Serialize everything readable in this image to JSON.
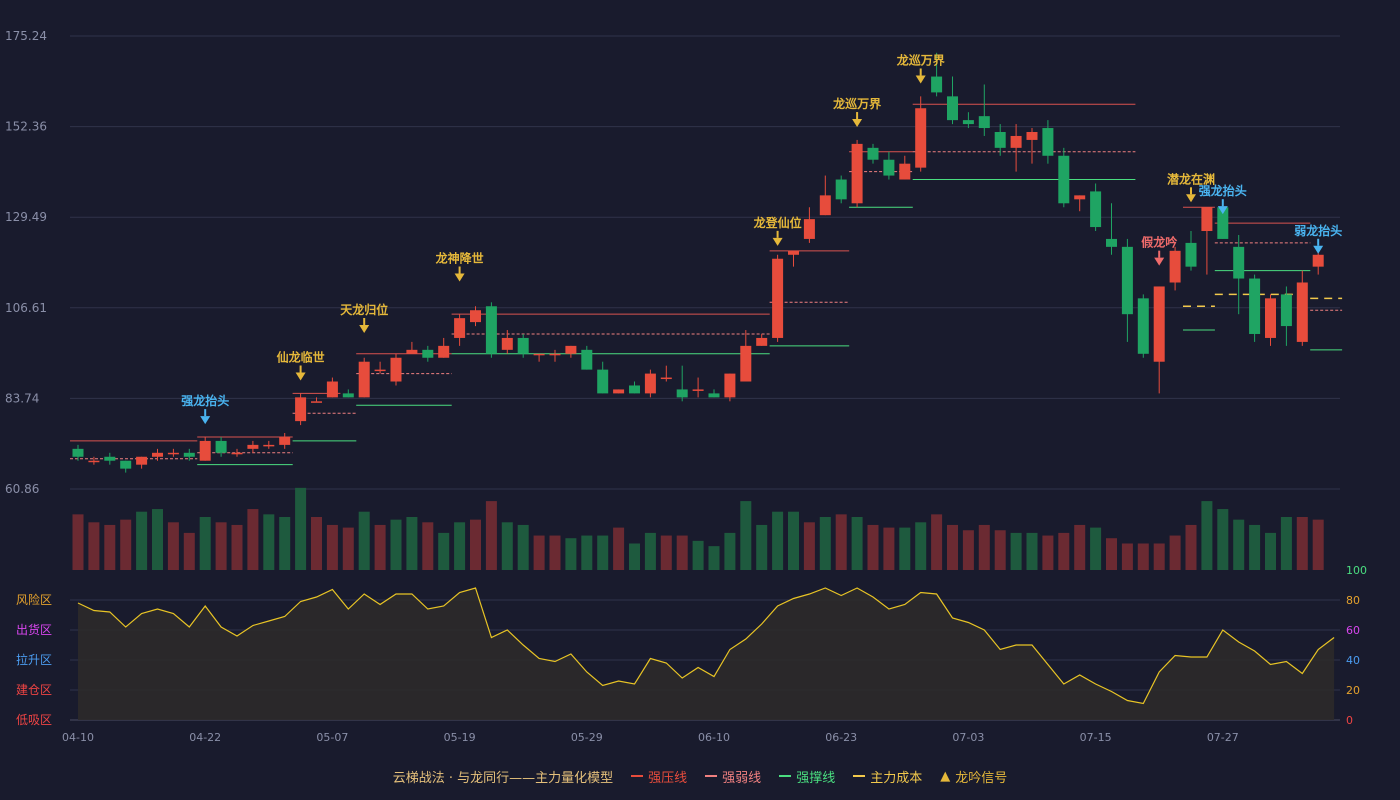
{
  "chart_data": {
    "type": "candlestick",
    "x_tick_labels": [
      "04-10",
      "04-22",
      "05-07",
      "05-19",
      "05-29",
      "06-10",
      "06-23",
      "07-03",
      "07-15",
      "07-27"
    ],
    "price_axis": {
      "ticks": [
        "175.24",
        "152.36",
        "129.49",
        "106.61",
        "83.74",
        "60.86"
      ],
      "range": [
        60.86,
        175.24
      ]
    },
    "indicator_axis": {
      "ticks": [
        0,
        20,
        40,
        60,
        80,
        100
      ],
      "range": [
        0,
        100
      ]
    },
    "zone_labels": [
      {
        "text": "风险区",
        "color": "#e5a22d"
      },
      {
        "text": "出货区",
        "color": "#d946ef"
      },
      {
        "text": "拉升区",
        "color": "#4b9cf0"
      },
      {
        "text": "建仓区",
        "color": "#ef4444"
      },
      {
        "text": "低吸区",
        "color": "#ef4444"
      }
    ],
    "colors": {
      "up": "#e74c3c",
      "down": "#1fa463",
      "grid": "#30334a",
      "indicator": "#e8c425",
      "support": "#4ade80",
      "cost": "#f2c94c"
    },
    "candles": [
      [
        71,
        69,
        72,
        68
      ],
      [
        68,
        68,
        69,
        67
      ],
      [
        69,
        68,
        70,
        67
      ],
      [
        68,
        66,
        68,
        65
      ],
      [
        67,
        69,
        69,
        66
      ],
      [
        69,
        70,
        71,
        68
      ],
      [
        70,
        70,
        71,
        69
      ],
      [
        70,
        69,
        71,
        68
      ],
      [
        68,
        73,
        74,
        68
      ],
      [
        73,
        70,
        74,
        69
      ],
      [
        70,
        70,
        71,
        69
      ],
      [
        71,
        72,
        73,
        70
      ],
      [
        72,
        72,
        73,
        71
      ],
      [
        72,
        74,
        75,
        71
      ],
      [
        78,
        84,
        85,
        77
      ],
      [
        83,
        83,
        84,
        83
      ],
      [
        84,
        88,
        89,
        84
      ],
      [
        85,
        84,
        86,
        84
      ],
      [
        84,
        93,
        94,
        84
      ],
      [
        91,
        91,
        93,
        90
      ],
      [
        88,
        94,
        95,
        87
      ],
      [
        95,
        96,
        98,
        95
      ],
      [
        96,
        94,
        97,
        93
      ],
      [
        94,
        97,
        99,
        94
      ],
      [
        99,
        104,
        105,
        97
      ],
      [
        103,
        106,
        107,
        102
      ],
      [
        107,
        95,
        108,
        94
      ],
      [
        96,
        99,
        101,
        95
      ],
      [
        99,
        95,
        100,
        94
      ],
      [
        95,
        95,
        95,
        93
      ],
      [
        95,
        95,
        96,
        93
      ],
      [
        95,
        97,
        97,
        94
      ],
      [
        96,
        91,
        97,
        91
      ],
      [
        91,
        85,
        93,
        85
      ],
      [
        85,
        86,
        86,
        85
      ],
      [
        87,
        85,
        88,
        85
      ],
      [
        85,
        90,
        91,
        84
      ],
      [
        89,
        89,
        92,
        88
      ],
      [
        86,
        84,
        92,
        83
      ],
      [
        86,
        86,
        89,
        84
      ],
      [
        85,
        84,
        86,
        84
      ],
      [
        84,
        90,
        90,
        83
      ],
      [
        88,
        97,
        101,
        88
      ],
      [
        97,
        99,
        100,
        97
      ],
      [
        99,
        119,
        120,
        98
      ],
      [
        120,
        121,
        121,
        117
      ],
      [
        124,
        129,
        132,
        123
      ],
      [
        130,
        135,
        140,
        130
      ],
      [
        139,
        134,
        140,
        133
      ],
      [
        133,
        148,
        149,
        132
      ],
      [
        147,
        144,
        148,
        143
      ],
      [
        144,
        140,
        146,
        139
      ],
      [
        139,
        143,
        145,
        139
      ],
      [
        142,
        157,
        160,
        141
      ],
      [
        165,
        161,
        171,
        160
      ],
      [
        160,
        154,
        165,
        153
      ],
      [
        154,
        153,
        156,
        152
      ],
      [
        155,
        152,
        163,
        150
      ],
      [
        151,
        147,
        153,
        145
      ],
      [
        147,
        150,
        153,
        141
      ],
      [
        149,
        151,
        152,
        143
      ],
      [
        152,
        145,
        154,
        143
      ],
      [
        145,
        133,
        147,
        132
      ],
      [
        134,
        135,
        135,
        131
      ],
      [
        136,
        127,
        138,
        126
      ],
      [
        124,
        122,
        133,
        120
      ],
      [
        122,
        105,
        124,
        98
      ],
      [
        109,
        95,
        110,
        94
      ],
      [
        93,
        112,
        112,
        85
      ],
      [
        113,
        121,
        122,
        111
      ],
      [
        123,
        117,
        126,
        116
      ],
      [
        126,
        132,
        132,
        115
      ],
      [
        132,
        124,
        133,
        124
      ],
      [
        122,
        114,
        125,
        105
      ],
      [
        114,
        100,
        115,
        98
      ],
      [
        99,
        109,
        110,
        97
      ],
      [
        110,
        102,
        112,
        97
      ],
      [
        98,
        113,
        116,
        97
      ],
      [
        117,
        120,
        121,
        115
      ]
    ],
    "volume": [
      [
        21,
        "up"
      ],
      [
        18,
        "up"
      ],
      [
        17,
        "up"
      ],
      [
        19,
        "up"
      ],
      [
        22,
        "down"
      ],
      [
        23,
        "down"
      ],
      [
        18,
        "up"
      ],
      [
        14,
        "up"
      ],
      [
        20,
        "down"
      ],
      [
        18,
        "up"
      ],
      [
        17,
        "up"
      ],
      [
        23,
        "up"
      ],
      [
        21,
        "down"
      ],
      [
        20,
        "down"
      ],
      [
        31,
        "down"
      ],
      [
        20,
        "up"
      ],
      [
        17,
        "up"
      ],
      [
        16,
        "up"
      ],
      [
        22,
        "down"
      ],
      [
        17,
        "up"
      ],
      [
        19,
        "down"
      ],
      [
        20,
        "down"
      ],
      [
        18,
        "up"
      ],
      [
        14,
        "down"
      ],
      [
        18,
        "down"
      ],
      [
        19,
        "up"
      ],
      [
        26,
        "up"
      ],
      [
        18,
        "down"
      ],
      [
        17,
        "down"
      ],
      [
        13,
        "up"
      ],
      [
        13,
        "up"
      ],
      [
        12,
        "down"
      ],
      [
        13,
        "down"
      ],
      [
        13,
        "down"
      ],
      [
        16,
        "up"
      ],
      [
        10,
        "down"
      ],
      [
        14,
        "down"
      ],
      [
        13,
        "up"
      ],
      [
        13,
        "up"
      ],
      [
        11,
        "down"
      ],
      [
        9,
        "down"
      ],
      [
        14,
        "down"
      ],
      [
        26,
        "down"
      ],
      [
        17,
        "down"
      ],
      [
        22,
        "down"
      ],
      [
        22,
        "down"
      ],
      [
        18,
        "up"
      ],
      [
        20,
        "down"
      ],
      [
        21,
        "up"
      ],
      [
        20,
        "down"
      ],
      [
        17,
        "up"
      ],
      [
        16,
        "up"
      ],
      [
        16,
        "down"
      ],
      [
        18,
        "down"
      ],
      [
        21,
        "up"
      ],
      [
        17,
        "up"
      ],
      [
        15,
        "up"
      ],
      [
        17,
        "up"
      ],
      [
        15,
        "up"
      ],
      [
        14,
        "down"
      ],
      [
        14,
        "down"
      ],
      [
        13,
        "up"
      ],
      [
        14,
        "up"
      ],
      [
        17,
        "up"
      ],
      [
        16,
        "down"
      ],
      [
        12,
        "up"
      ],
      [
        10,
        "up"
      ],
      [
        10,
        "up"
      ],
      [
        10,
        "up"
      ],
      [
        13,
        "up"
      ],
      [
        17,
        "up"
      ],
      [
        26,
        "down"
      ],
      [
        23,
        "down"
      ],
      [
        19,
        "down"
      ],
      [
        17,
        "down"
      ],
      [
        14,
        "down"
      ],
      [
        20,
        "down"
      ],
      [
        20,
        "up"
      ],
      [
        19,
        "up"
      ]
    ],
    "indicator": [
      78,
      73,
      72,
      62,
      71,
      74,
      71,
      62,
      76,
      62,
      56,
      63,
      66,
      69,
      79,
      82,
      87,
      74,
      84,
      77,
      84,
      84,
      74,
      76,
      85,
      88,
      55,
      60,
      50,
      41,
      39,
      44,
      32,
      23,
      26,
      24,
      41,
      38,
      28,
      35,
      29,
      47,
      54,
      64,
      76,
      81,
      84,
      88,
      83,
      88,
      82,
      74,
      77,
      85,
      84,
      68,
      65,
      60,
      47,
      50,
      50,
      37,
      24,
      30,
      24,
      19,
      13,
      11,
      32,
      43,
      42,
      42,
      60,
      52,
      46,
      37,
      39,
      31,
      47,
      55
    ],
    "signals": [
      {
        "text": "强龙抬头",
        "index": 8,
        "price": 77,
        "color": "#4ab4f0"
      },
      {
        "text": "仙龙临世",
        "index": 14,
        "price": 88,
        "color": "#e5b83a"
      },
      {
        "text": "天龙归位",
        "index": 18,
        "price": 100,
        "color": "#e5b83a"
      },
      {
        "text": "龙神降世",
        "index": 24,
        "price": 113,
        "color": "#e5b83a"
      },
      {
        "text": "龙登仙位",
        "index": 44,
        "price": 122,
        "color": "#e5b83a"
      },
      {
        "text": "龙巡万界",
        "index": 49,
        "price": 152,
        "color": "#e5b83a"
      },
      {
        "text": "龙巡万界",
        "index": 53,
        "price": 163,
        "color": "#e5b83a"
      },
      {
        "text": "潜龙在渊",
        "index": 70,
        "price": 133,
        "color": "#e5b83a"
      },
      {
        "text": "假龙吟",
        "index": 68,
        "price": 117,
        "color": "#ef6b6b"
      },
      {
        "text": "强龙抬头",
        "index": 72,
        "price": 130,
        "color": "#4ab4f0"
      },
      {
        "text": "弱龙抬头",
        "index": 78,
        "price": 120,
        "color": "#4ab4f0"
      }
    ],
    "levels": [
      {
        "kind": "strong_pressure",
        "start": 0,
        "end": 7,
        "price": 73
      },
      {
        "kind": "weak_pressure",
        "start": 0,
        "end": 7,
        "price": 68.5
      },
      {
        "kind": "strong_pressure",
        "start": 8,
        "end": 13,
        "price": 74
      },
      {
        "kind": "weak_pressure",
        "start": 8,
        "end": 13,
        "price": 70
      },
      {
        "kind": "support",
        "start": 8,
        "end": 13,
        "price": 67
      },
      {
        "kind": "strong_pressure",
        "start": 14,
        "end": 16,
        "price": 85
      },
      {
        "kind": "weak_pressure",
        "start": 14,
        "end": 17,
        "price": 80
      },
      {
        "kind": "support",
        "start": 14,
        "end": 17,
        "price": 73
      },
      {
        "kind": "strong_pressure",
        "start": 18,
        "end": 23,
        "price": 95
      },
      {
        "kind": "weak_pressure",
        "start": 18,
        "end": 23,
        "price": 90
      },
      {
        "kind": "support",
        "start": 18,
        "end": 23,
        "price": 82
      },
      {
        "kind": "strong_pressure",
        "start": 24,
        "end": 43,
        "price": 105
      },
      {
        "kind": "weak_pressure",
        "start": 24,
        "end": 43,
        "price": 100
      },
      {
        "kind": "support",
        "start": 24,
        "end": 43,
        "price": 95
      },
      {
        "kind": "strong_pressure",
        "start": 44,
        "end": 48,
        "price": 121
      },
      {
        "kind": "weak_pressure",
        "start": 44,
        "end": 48,
        "price": 108
      },
      {
        "kind": "support",
        "start": 44,
        "end": 48,
        "price": 97
      },
      {
        "kind": "strong_pressure",
        "start": 49,
        "end": 52,
        "price": 146
      },
      {
        "kind": "weak_pressure",
        "start": 49,
        "end": 52,
        "price": 141
      },
      {
        "kind": "support",
        "start": 49,
        "end": 52,
        "price": 132
      },
      {
        "kind": "strong_pressure",
        "start": 53,
        "end": 66,
        "price": 158
      },
      {
        "kind": "weak_pressure",
        "start": 53,
        "end": 66,
        "price": 146
      },
      {
        "kind": "support",
        "start": 53,
        "end": 66,
        "price": 139
      },
      {
        "kind": "strong_pressure",
        "start": 70,
        "end": 71,
        "price": 132
      },
      {
        "kind": "cost",
        "start": 70,
        "end": 71,
        "price": 107
      },
      {
        "kind": "support",
        "start": 70,
        "end": 71,
        "price": 101
      },
      {
        "kind": "strong_pressure",
        "start": 72,
        "end": 77,
        "price": 128
      },
      {
        "kind": "weak_pressure",
        "start": 72,
        "end": 77,
        "price": 123
      },
      {
        "kind": "support",
        "start": 72,
        "end": 77,
        "price": 116
      },
      {
        "kind": "cost",
        "start": 72,
        "end": 77,
        "price": 110
      },
      {
        "kind": "weak_pressure",
        "start": 78,
        "end": 79,
        "price": 106
      },
      {
        "kind": "cost",
        "start": 78,
        "end": 79,
        "price": 109
      },
      {
        "kind": "support",
        "start": 78,
        "end": 79,
        "price": 96
      }
    ]
  },
  "legend": {
    "title": "云梯战法 · 与龙同行——主力量化模型",
    "items": [
      {
        "label": "强压线",
        "color": "#e74c3c",
        "style": "solid"
      },
      {
        "label": "强弱线",
        "color": "#f08080",
        "style": "dashed"
      },
      {
        "label": "强撑线",
        "color": "#4ade80",
        "style": "solid"
      },
      {
        "label": "主力成本",
        "color": "#f2c94c",
        "style": "dashed"
      },
      {
        "label": "龙吟信号",
        "color": "#e5b83a",
        "style": "triangle"
      }
    ]
  }
}
